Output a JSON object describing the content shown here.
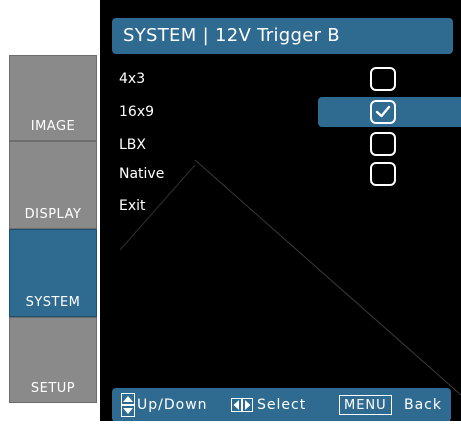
{
  "menu": {
    "title": "SYSTEM | 12V Trigger B",
    "options": [
      {
        "label": "4x3",
        "checked": false
      },
      {
        "label": "16x9",
        "checked": true
      },
      {
        "label": "LBX",
        "checked": false
      },
      {
        "label": "Native",
        "checked": false
      },
      {
        "label": "Exit"
      }
    ]
  },
  "tabs": [
    {
      "label": "IMAGE",
      "active": false
    },
    {
      "label": "DISPLAY",
      "active": false
    },
    {
      "label": "SYSTEM",
      "active": true
    },
    {
      "label": "SETUP",
      "active": false
    }
  ],
  "footer": {
    "up_down_label": "Up/Down",
    "select_label": "Select",
    "menu_key_label": "MENU",
    "back_label": "Back"
  },
  "colors": {
    "accent": "#2f6a91",
    "panel_background": "#000000",
    "tab_inactive": "#8a8a8a"
  },
  "icons": {
    "footer_up_down": "up-down-arrows-icon",
    "footer_select": "left-right-arrows-icon",
    "checked_box": "checkmark-icon"
  }
}
